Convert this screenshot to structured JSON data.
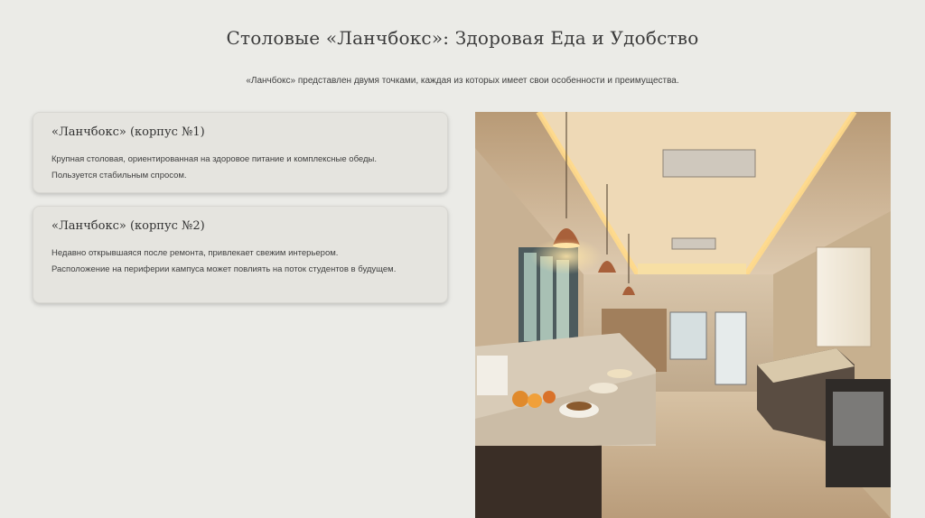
{
  "header": {
    "title": "Столовые «Ланчбокс»: Здоровая Еда и Удобство",
    "subtitle": "«Ланчбокс» представлен двумя точками, каждая из которых имеет свои особенности и преимущества."
  },
  "cards": [
    {
      "title": "«Ланчбокс» (корпус №1)",
      "lines": [
        "Крупная столовая, ориентированная на здоровое питание и комплексные обеды.",
        "Пользуется стабильным спросом."
      ]
    },
    {
      "title": "«Ланчбокс» (корпус №2)",
      "lines": [
        "Недавно открывшаяся после ремонта, привлекает свежим интерьером.",
        "Расположение на периферии кампуса может повлиять на поток студентов в будущем."
      ]
    }
  ],
  "colors": {
    "background": "#ebebe7",
    "card": "#e5e4df",
    "ceiling_light": "#f3c877"
  }
}
